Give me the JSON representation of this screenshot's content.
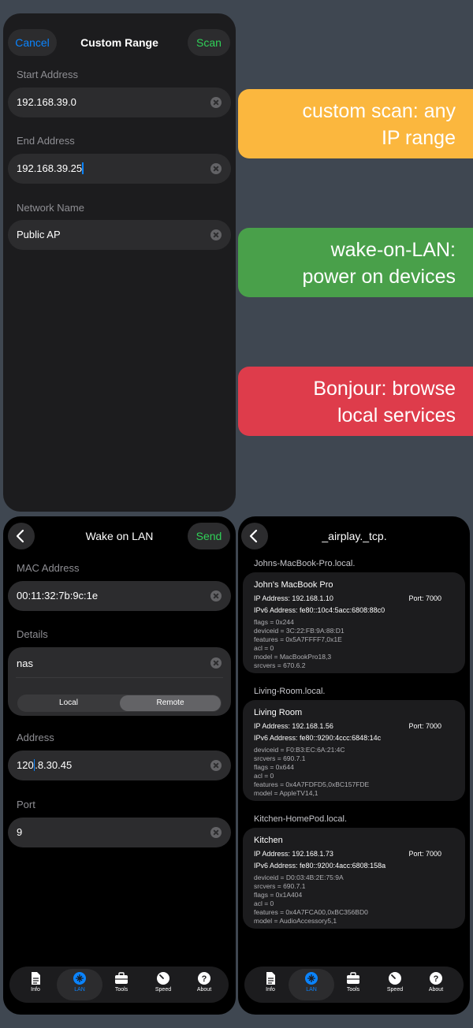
{
  "custom_range": {
    "cancel_label": "Cancel",
    "title": "Custom Range",
    "scan_label": "Scan",
    "start_label": "Start Address",
    "start_value": "192.168.39.0",
    "end_label": "End Address",
    "end_value": "192.168.39.25",
    "network_label": "Network Name",
    "network_value": "Public AP"
  },
  "banners": [
    {
      "line1": "custom scan: any",
      "line2": "IP range",
      "color": "#fbb73e"
    },
    {
      "line1": "wake-on-LAN:",
      "line2": "power on devices",
      "color": "#49a04a"
    },
    {
      "line1": "Bonjour: browse",
      "line2": "local services",
      "color": "#de3c4b"
    }
  ],
  "wol": {
    "title": "Wake on LAN",
    "send_label": "Send",
    "mac_label": "MAC Address",
    "mac_value": "00:11:32:7b:9c:1e",
    "details_label": "Details",
    "details_value": "nas",
    "seg_local": "Local",
    "seg_remote": "Remote",
    "seg_selected": "Remote",
    "address_label": "Address",
    "address_value_a": "120",
    "address_value_b": ".8.30.45",
    "port_label": "Port",
    "port_value": "9"
  },
  "tabs": [
    "Info",
    "LAN",
    "Tools",
    "Speed",
    "About"
  ],
  "active_tab": "LAN",
  "bonjour": {
    "title": "_airplay._tcp.",
    "services": [
      {
        "host": "Johns-MacBook-Pro.local.",
        "name": "John's MacBook Pro",
        "ip": "IP Address: 192.168.1.10",
        "port": "Port: 7000",
        "ipv6": "IPv6 Address: fe80::10c4:5acc:6808:88c0",
        "records": [
          "flags = 0x244",
          "deviceid = 3C:22:FB:9A:88:D1",
          "features = 0x5A7FFFF7,0x1E",
          "acl = 0",
          "model = MacBookPro18,3",
          "srcvers = 670.6.2"
        ]
      },
      {
        "host": "Living-Room.local.",
        "name": "Living Room",
        "ip": "IP Address: 192.168.1.56",
        "port": "Port: 7000",
        "ipv6": "IPv6 Address: fe80::9290:4ccc:6848:14c",
        "records": [
          "deviceid = F0:B3:EC:6A:21:4C",
          "srcvers = 690.7.1",
          "flags = 0x644",
          "acl = 0",
          "features = 0x4A7FDFD5,0xBC157FDE",
          "model = AppleTV14,1"
        ]
      },
      {
        "host": "Kitchen-HomePod.local.",
        "name": "Kitchen",
        "ip": "IP Address: 192.168.1.73",
        "port": "Port: 7000",
        "ipv6": "IPv6 Address: fe80::9200:4acc:6808:158a",
        "records": [
          "deviceid = D0:03:4B:2E:75:9A",
          "srcvers = 690.7.1",
          "flags = 0x1A404",
          "acl = 0",
          "features = 0x4A7FCA00,0xBC356BD0",
          "model = AudioAccessory5,1"
        ]
      }
    ]
  },
  "colors": {
    "accent": "#0a84ff",
    "send": "#30d158",
    "background": "#3f4751"
  }
}
